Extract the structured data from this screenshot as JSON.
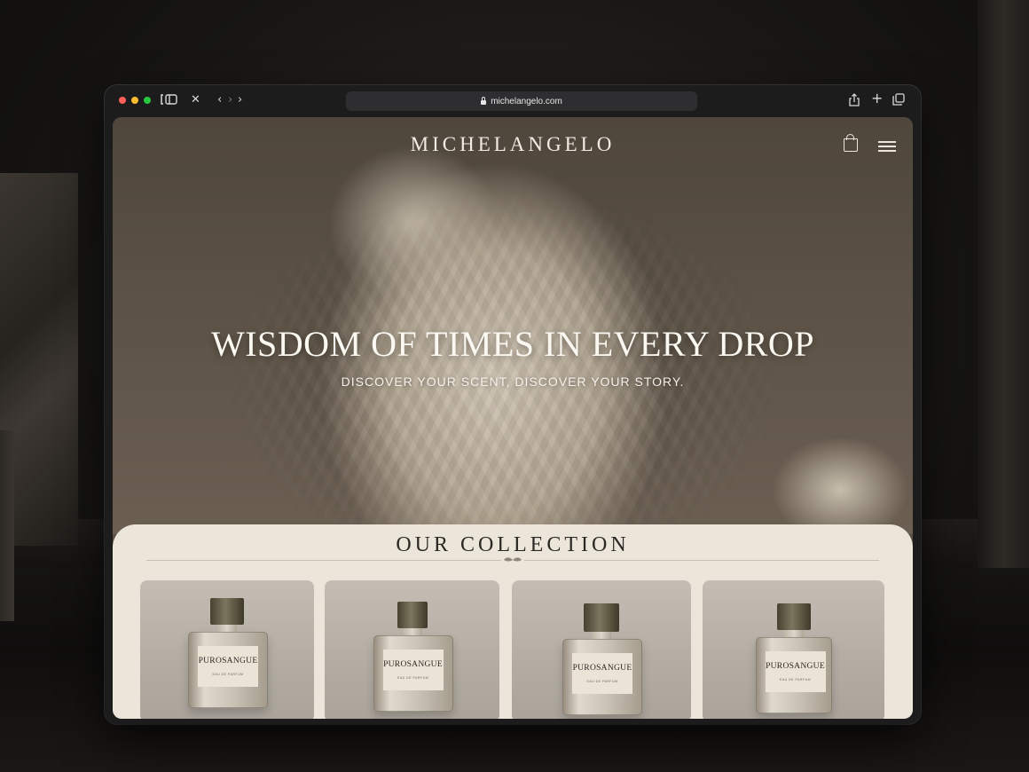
{
  "browser": {
    "url": "michelangelo.com",
    "icons": [
      "close-icon",
      "back-icon",
      "forward-icon",
      "share-icon",
      "new-tab-icon",
      "tabs-icon"
    ]
  },
  "site": {
    "brand": "MICHELANGELO",
    "headline": "WISDOM OF TIMES IN EVERY DROP",
    "subheadline": "DISCOVER YOUR SCENT, DISCOVER YOUR STORY."
  },
  "collection": {
    "title": "OUR COLLECTION",
    "products": [
      {
        "name": "PUROSANGUE",
        "sub": "EAU DE PARFUM"
      },
      {
        "name": "PUROSANGUE",
        "sub": "EAU DE PARFUM"
      },
      {
        "name": "PUROSANGUE",
        "sub": "EAU DE PARFUM"
      },
      {
        "name": "PUROSANGUE",
        "sub": "EAU DE PARFUM"
      }
    ]
  },
  "colors": {
    "panel": "#ebe5da",
    "brand_text": "#f2ede4",
    "cap": "#6b6552"
  }
}
